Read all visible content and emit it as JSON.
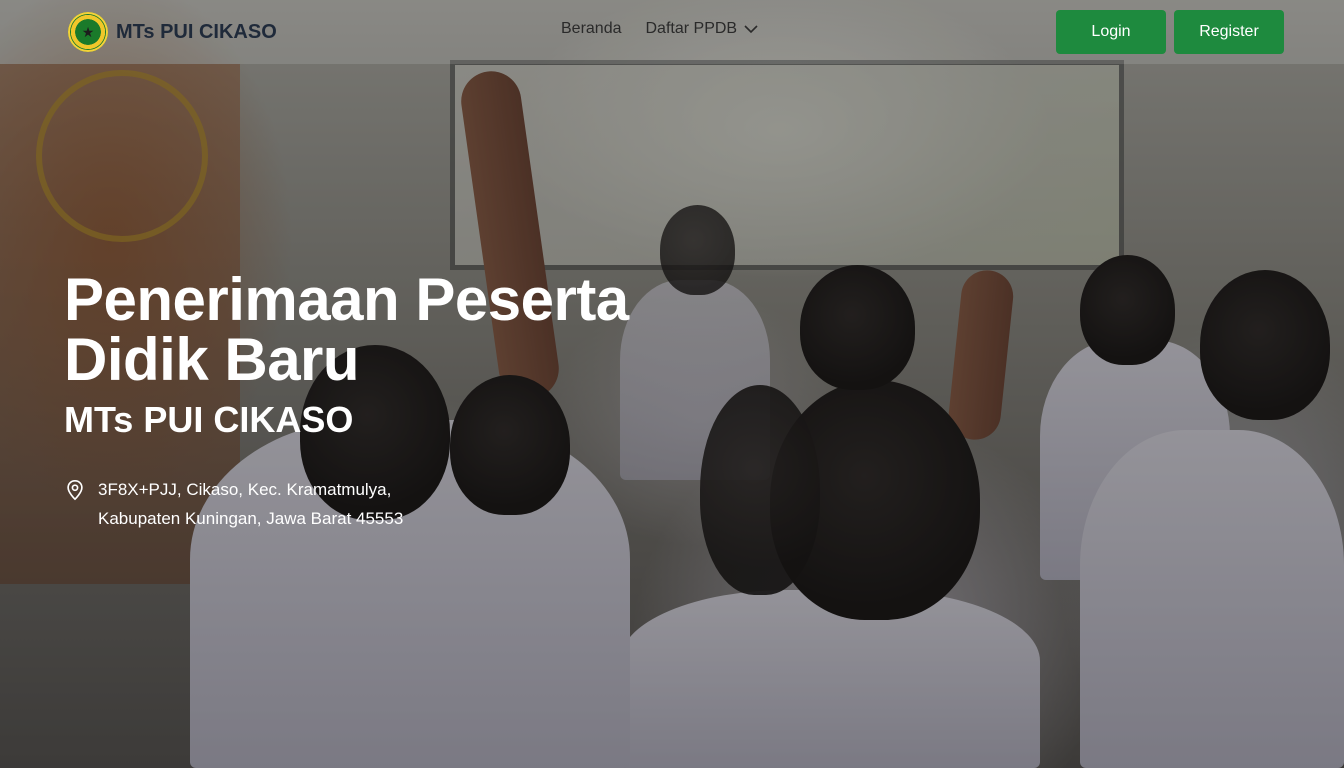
{
  "brand": {
    "name": "MTs PUI CIKASO",
    "logo_icon": "school-emblem-icon",
    "accent": "#1e8a3e"
  },
  "nav": {
    "items": [
      {
        "label": "Beranda"
      },
      {
        "label": "Daftar PPDB",
        "icon": "chevron-down-icon"
      }
    ],
    "login_label": "Login",
    "register_label": "Register"
  },
  "hero": {
    "title": "Penerimaan Peserta Didik Baru",
    "subtitle": "MTs PUI CIKASO",
    "address_icon": "location-pin-icon",
    "address_line1": "3F8X+PJJ, Cikaso, Kec. Kramatmulya,",
    "address_line2": "Kabupaten Kuningan, Jawa Barat 45553"
  }
}
